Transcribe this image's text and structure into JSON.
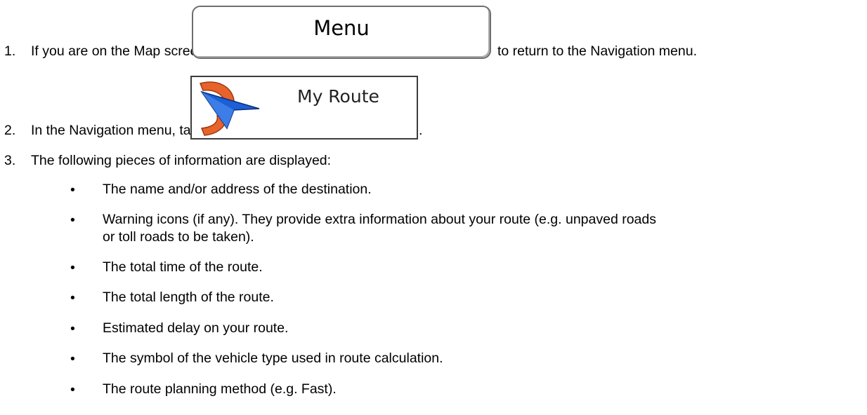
{
  "steps": [
    {
      "num": "1.",
      "before": "If you are on the Map screen, tap",
      "button": "Menu",
      "after": "to return to the Navigation menu."
    },
    {
      "num": "2.",
      "before": "In the Navigation menu, tap",
      "button": "My Route",
      "after": "."
    },
    {
      "num": "3.",
      "text": "The following pieces of information are displayed:"
    }
  ],
  "bullet_char": "•",
  "bullets": [
    "The name and/or address of the destination.",
    "Warning icons (if any). They provide extra information about your route (e.g. unpaved roads",
    "or toll roads to be taken).",
    "The total time of the route.",
    "The total length of the route.",
    "Estimated delay on your route.",
    "The symbol of the vehicle type used in route calculation.",
    "The route planning method (e.g. Fast)."
  ],
  "colors": {
    "route_arrow_orange": "#e8632b",
    "route_arrow_blue": "#1c5fd6"
  }
}
